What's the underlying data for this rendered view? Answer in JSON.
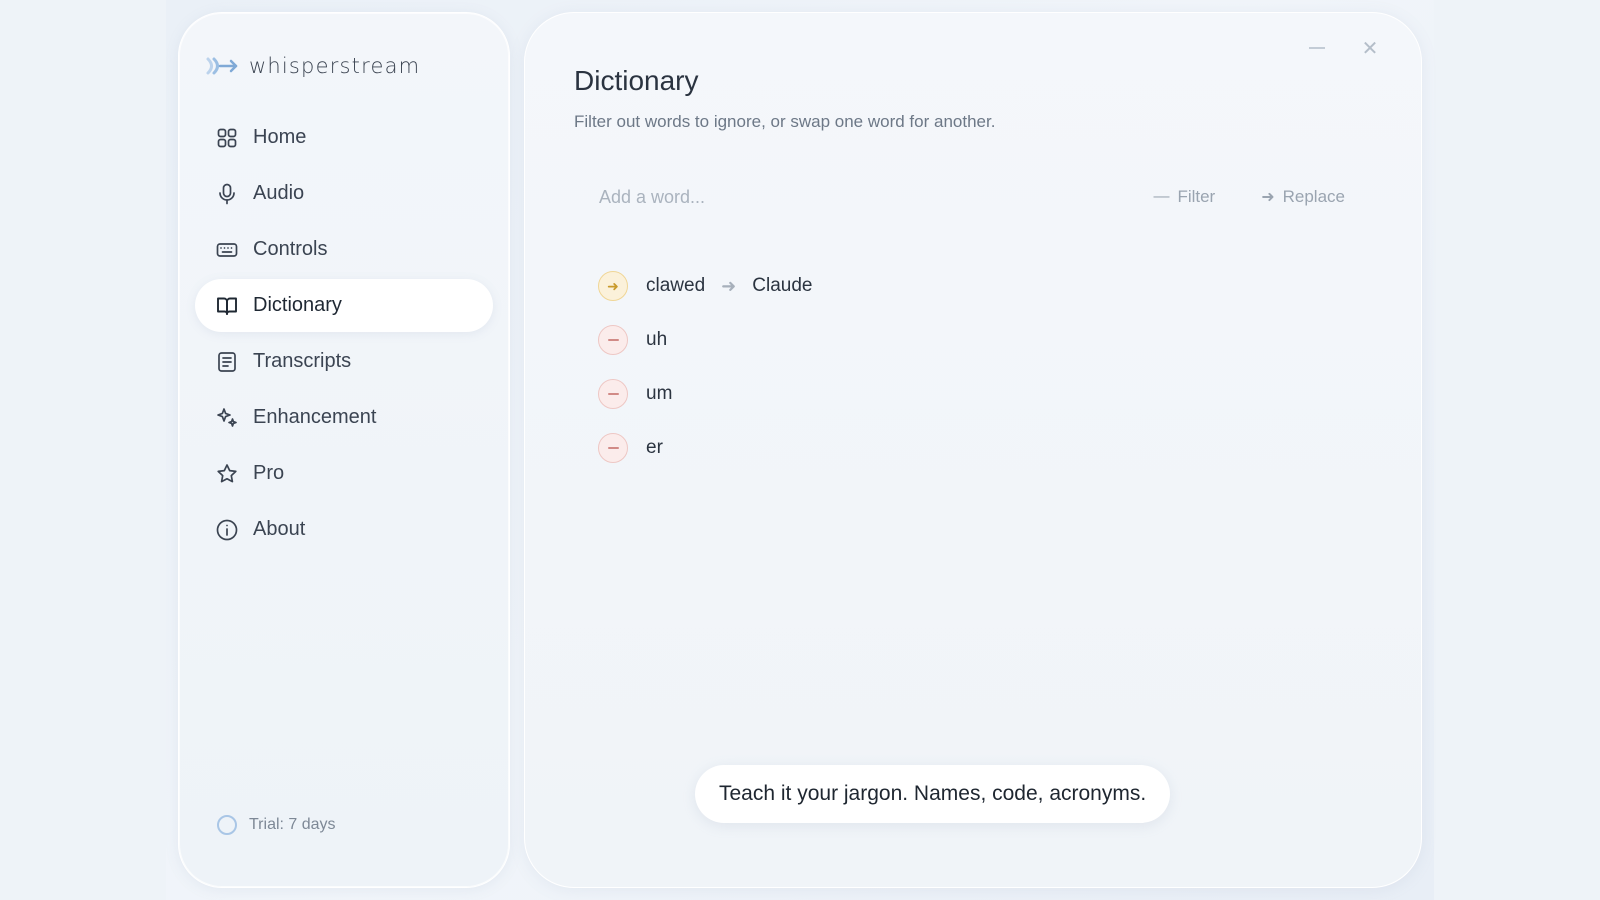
{
  "app": {
    "name": "whisperstream",
    "logo_icon": "waveform-arrow-icon"
  },
  "sidebar": {
    "items": [
      {
        "label": "Home",
        "icon": "grid-icon",
        "active": false
      },
      {
        "label": "Audio",
        "icon": "microphone-icon",
        "active": false
      },
      {
        "label": "Controls",
        "icon": "keyboard-icon",
        "active": false
      },
      {
        "label": "Dictionary",
        "icon": "book-icon",
        "active": true
      },
      {
        "label": "Transcripts",
        "icon": "document-icon",
        "active": false
      },
      {
        "label": "Enhancement",
        "icon": "sparkle-icon",
        "active": false
      },
      {
        "label": "Pro",
        "icon": "star-icon",
        "active": false
      },
      {
        "label": "About",
        "icon": "info-icon",
        "active": false
      }
    ],
    "trial_label": "Trial: 7 days"
  },
  "main": {
    "title": "Dictionary",
    "subtitle": "Filter out words to ignore, or swap one word for another.",
    "add_placeholder": "Add a word...",
    "filter_label": "Filter",
    "replace_label": "Replace",
    "entries": [
      {
        "type": "replace",
        "word": "clawed",
        "replacement": "Claude"
      },
      {
        "type": "filter",
        "word": "uh"
      },
      {
        "type": "filter",
        "word": "um"
      },
      {
        "type": "filter",
        "word": "er"
      }
    ],
    "toast": "Teach it your jargon. Names, code, acronyms."
  },
  "colors": {
    "accent_blue": "#a9c6e6",
    "replace_badge": "#f0d696",
    "filter_badge": "#eec7c4"
  }
}
